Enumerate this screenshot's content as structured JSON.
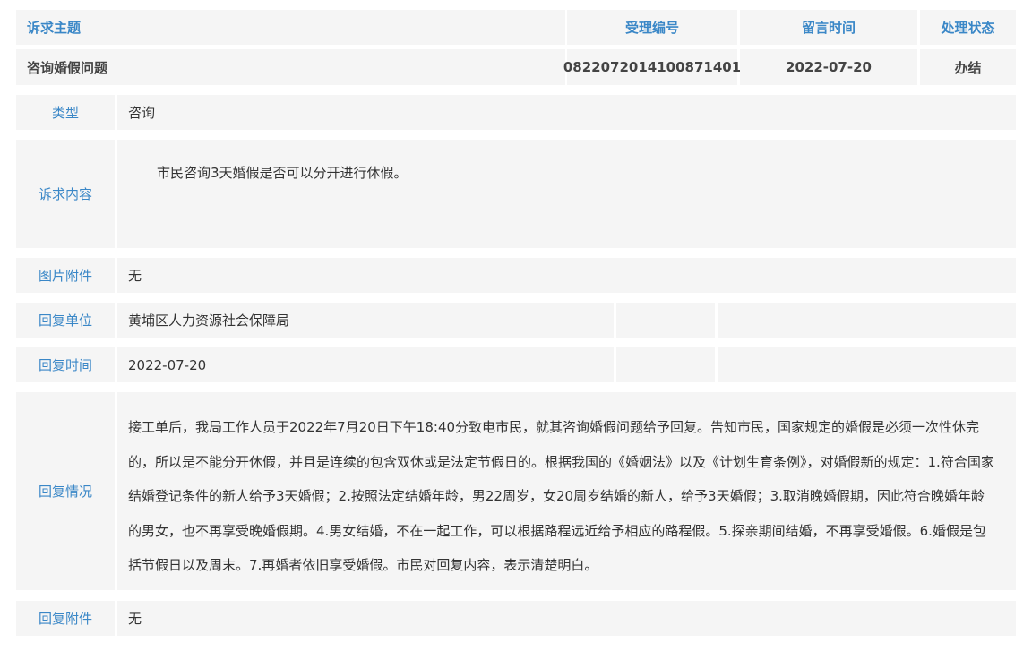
{
  "header": {
    "subject": "诉求主题",
    "number": "受理编号",
    "time": "留言时间",
    "status": "处理状态"
  },
  "record": {
    "subject": "咨询婚假问题",
    "number": "0822072014100871401",
    "time": "2022-07-20",
    "status": "办结"
  },
  "details": {
    "type_label": "类型",
    "type_value": "咨询",
    "content_label": "诉求内容",
    "content_value": "市民咨询3天婚假是否可以分开进行休假。",
    "image_label": "图片附件",
    "image_value": "无",
    "unit_label": "回复单位",
    "unit_value": "黄埔区人力资源社会保障局",
    "reply_time_label": "回复时间",
    "reply_time_value": "2022-07-20",
    "reply_label": "回复情况",
    "reply_value": "接工单后，我局工作人员于2022年7月20日下午18:40分致电市民，就其咨询婚假问题给予回复。告知市民，国家规定的婚假是必须一次性休完的，所以是不能分开休假，并且是连续的包含双休或是法定节假日的。根据我国的《婚姻法》以及《计划生育条例》，对婚假新的规定：1.符合国家结婚登记条件的新人给予3天婚假；2.按照法定结婚年龄，男22周岁，女20周岁结婚的新人，给予3天婚假；3.取消晚婚假期，因此符合晚婚年龄的男女，也不再享受晚婚假期。4.男女结婚，不在一起工作，可以根据路程远近给予相应的路程假。5.探亲期间结婚，不再享受婚假。6.婚假是包括节假日以及周末。7.再婚者依旧享受婚假。市民对回复内容，表示清楚明白。",
    "reply_attach_label": "回复附件",
    "reply_attach_value": "无"
  },
  "colors": {
    "accent": "#3a87c7",
    "cell_bg": "#f5f5f5",
    "text": "#333333"
  }
}
